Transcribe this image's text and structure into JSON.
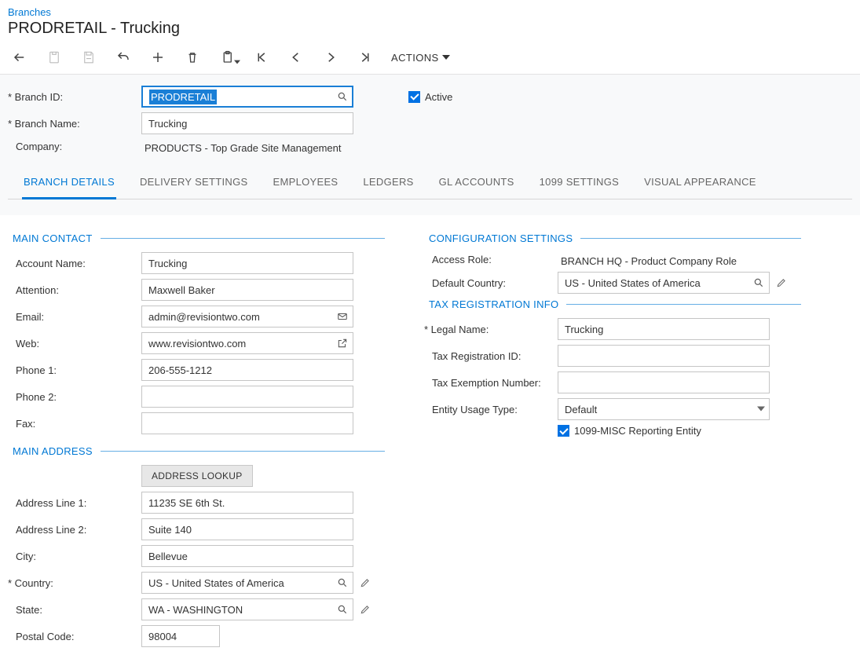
{
  "breadcrumb": "Branches",
  "page_title": "PRODRETAIL - Trucking",
  "toolbar": {
    "actions_label": "ACTIONS"
  },
  "header_form": {
    "branch_id_label": "Branch ID:",
    "branch_id_value": "PRODRETAIL",
    "branch_name_label": "Branch Name:",
    "branch_name_value": "Trucking",
    "company_label": "Company:",
    "company_value": "PRODUCTS - Top Grade Site Management",
    "active_label": "Active"
  },
  "tabs": [
    "BRANCH DETAILS",
    "DELIVERY SETTINGS",
    "EMPLOYEES",
    "LEDGERS",
    "GL ACCOUNTS",
    "1099 SETTINGS",
    "VISUAL APPEARANCE"
  ],
  "main_contact": {
    "header": "MAIN CONTACT",
    "account_name_label": "Account Name:",
    "account_name_value": "Trucking",
    "attention_label": "Attention:",
    "attention_value": "Maxwell Baker",
    "email_label": "Email:",
    "email_value": "admin@revisiontwo.com",
    "web_label": "Web:",
    "web_value": "www.revisiontwo.com",
    "phone1_label": "Phone 1:",
    "phone1_value": "206-555-1212",
    "phone2_label": "Phone 2:",
    "phone2_value": "",
    "fax_label": "Fax:",
    "fax_value": ""
  },
  "main_address": {
    "header": "MAIN ADDRESS",
    "lookup_label": "ADDRESS LOOKUP",
    "line1_label": "Address Line 1:",
    "line1_value": "11235 SE 6th St.",
    "line2_label": "Address Line 2:",
    "line2_value": "Suite 140",
    "city_label": "City:",
    "city_value": "Bellevue",
    "country_label": "Country:",
    "country_value": "US - United States of America",
    "state_label": "State:",
    "state_value": "WA - WASHINGTON",
    "postal_label": "Postal Code:",
    "postal_value": "98004"
  },
  "config": {
    "header": "CONFIGURATION SETTINGS",
    "access_role_label": "Access Role:",
    "access_role_value": "BRANCH HQ - Product Company Role",
    "default_country_label": "Default Country:",
    "default_country_value": "US - United States of America"
  },
  "tax": {
    "header": "TAX REGISTRATION INFO",
    "legal_name_label": "Legal Name:",
    "legal_name_value": "Trucking",
    "tax_reg_label": "Tax Registration ID:",
    "tax_reg_value": "",
    "tax_exempt_label": "Tax Exemption Number:",
    "tax_exempt_value": "",
    "entity_usage_label": "Entity Usage Type:",
    "entity_usage_value": "Default",
    "misc_label": "1099-MISC Reporting Entity"
  }
}
